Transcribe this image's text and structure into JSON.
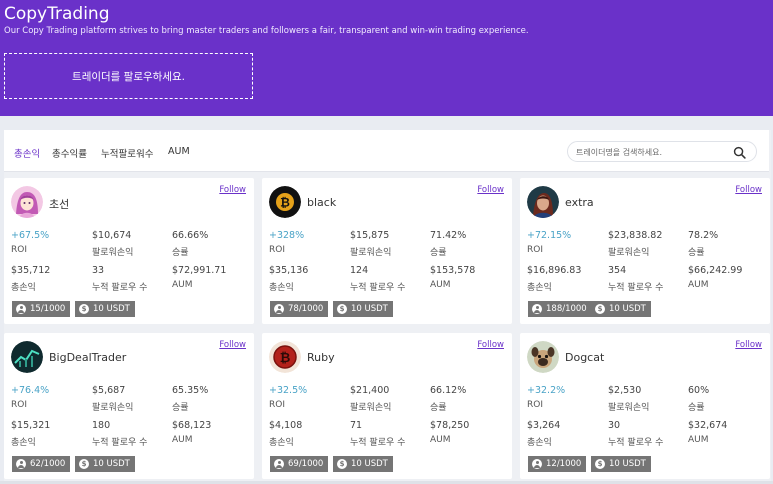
{
  "hero": {
    "title": "CopyTrading",
    "subtitle": "Our Copy Trading platform strives to bring master traders and followers a fair, transparent and win-win trading experience.",
    "cta": "트레이더를 팔로우하세요."
  },
  "tabs": [
    "총손익",
    "총수익률",
    "누적팔로워수",
    "AUM"
  ],
  "search": {
    "placeholder": "트레이더명을 검색하세요."
  },
  "card_labels": {
    "follow": "Follow",
    "roi": "ROI",
    "follower_pnl": "팔로워손익",
    "win_rate": "승률",
    "total_pnl": "총손익",
    "cum_followers": "누적 팔로우 수",
    "aum": "AUM"
  },
  "traders": [
    {
      "name": "초선",
      "roi": "+67.5%",
      "follower_pnl": "$10,674",
      "win_rate": "66.66%",
      "total_pnl": "$35,712",
      "cum_followers": "33",
      "aum": "$72,991.71",
      "slots": "15/1000",
      "min": "10 USDT",
      "avatar": "anime-girl"
    },
    {
      "name": "black",
      "roi": "+328%",
      "follower_pnl": "$15,875",
      "win_rate": "71.42%",
      "total_pnl": "$35,136",
      "cum_followers": "124",
      "aum": "$153,578",
      "slots": "78/1000",
      "min": "10 USDT",
      "avatar": "bitcoin-black"
    },
    {
      "name": "extra",
      "roi": "+72.15%",
      "follower_pnl": "$23,838.82",
      "win_rate": "78.2%",
      "total_pnl": "$16,896.83",
      "cum_followers": "354",
      "aum": "$66,242.99",
      "slots": "188/1000",
      "min": "10 USDT",
      "avatar": "dark-portrait"
    },
    {
      "name": "BigDealTrader",
      "roi": "+76.4%",
      "follower_pnl": "$5,687",
      "win_rate": "65.35%",
      "total_pnl": "$15,321",
      "cum_followers": "180",
      "aum": "$68,123",
      "slots": "62/1000",
      "min": "10 USDT",
      "avatar": "chart-dark"
    },
    {
      "name": "Ruby",
      "roi": "+32.5%",
      "follower_pnl": "$21,400",
      "win_rate": "66.12%",
      "total_pnl": "$4,108",
      "cum_followers": "71",
      "aum": "$78,250",
      "slots": "69/1000",
      "min": "10 USDT",
      "avatar": "bitcoin-red"
    },
    {
      "name": "Dogcat",
      "roi": "+32.2%",
      "follower_pnl": "$2,530",
      "win_rate": "60%",
      "total_pnl": "$3,264",
      "cum_followers": "30",
      "aum": "$32,674",
      "slots": "12/1000",
      "min": "10 USDT",
      "avatar": "dog"
    }
  ],
  "colors": {
    "brand": "#6a31c9",
    "roi_positive": "#4aa3c7",
    "badge": "#757575"
  }
}
